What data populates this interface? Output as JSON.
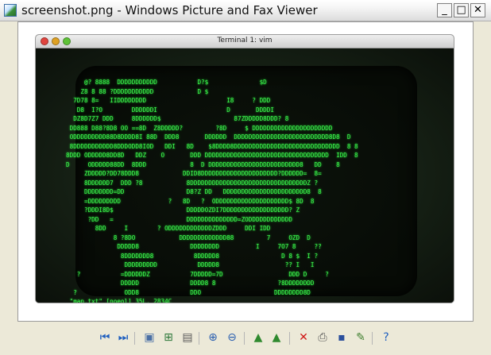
{
  "window": {
    "title": "screenshot.png - Windows Picture and Fax Viewer",
    "minimize_glyph": "_",
    "maximize_glyph": "□",
    "close_glyph": "✕"
  },
  "terminal": {
    "title": "Terminal 1: vim",
    "lines": [
      "     @? 8888  DDDDDDDDDDD           D?$              $D",
      "    Z8 8 88 ?DDDDDDDDDDD            D $",
      "  7D78 8=   IIDDDDDDDD                      I8     ? DDD",
      "   D8  I?O        DDDDDDI                   D       DDDDI",
      "  DZ8D7Z7 DDD     8DDDDDD$                    87ZDDDDD8DDD? 8",
      " DD888 D88?8D8 OO ==8D  Z8DDDDD?         ?8D     $ DDDDDDDDDDDDDDDDDDDDDD",
      " ODDDDDDDDD88D8DDDD8I 88D  DDD8       DDDDDD  DDDDDDDDDDDDDDDDDDDDDDDDDD8D8  D",
      " 8DDDDDDDDDDD8DDDODD8IOD   DDI   8D    $8DDDD8DDDDDDDDDDDDDDDDDDDDDDDDDDDDD  8 8",
      "8DDD ODDDDD8DD8D   DDZ    O       DDD DDDDDDDDDDDDDDDDDDDDDDDDDDDDDDDDDD  IDD  8",
      "D     ODDDDD88DD  8DDD            8  D DDDDDDDDDDDDDDDDDDDDDDDDD8   DD    8",
      "     ZDDDDD?DD78DDD8            DDID8DDDDDDDDDDDDDDDDDDDDD?DDDDDD=  8=",
      "     8DDDDDD7  DDD ?8            8DDDDDDDDDDDDDDDDDDDDDDDDDDDDDDDDZ ?",
      "     DDDDDDDD=DD                 D8?Z DD   DDDDDDDDDDDDDDDDDDDDDDD8  8",
      "     =DDDDDDDDD             ?   8D   ?  ODDDDDDDDDDDDDDDDDDDD$ 8D  8",
      "     ?DDDI8D$                    DDDDDOZDI7DDDDDDDDDDDDDDDDDD? Z",
      "      ?DD   =                    DDDDDDDDDDDDDD=ZODDDDDDDDDDDD",
      "        8DD     I        ? ODDDDDDDDDDDDZDDD     DDI IDD",
      "             8 ?8DO            DDDDDDDDDDDDD88         7     OZD  D",
      "              DDDDD8              DDDDDDDD          I     7O7 8     ??",
      "               8DDDDDDD8           8DDDDD8                 D 8 $  I ?",
      "                DDDDDDDDD           DDDDD8                  ?? I   I",
      "   ?           =DDDDDDZ           7DDDDD=7D                  DDD D     ?",
      "               DDDDD              DDDD8 8                 ?8DDDDDDDD",
      "  ?             ODD8              DDO                    DDDDDDDD8D",
      " \"map.txt\" [noeol] 35L, 2834C"
    ]
  },
  "toolbar": {
    "items": [
      {
        "name": "previous-image-button",
        "glyph": "⏮",
        "color": "#1f5fbf"
      },
      {
        "name": "next-image-button",
        "glyph": "⏭",
        "color": "#1f5fbf"
      },
      {
        "name": "best-fit-button",
        "glyph": "▣",
        "color": "#4a6fa5"
      },
      {
        "name": "actual-size-button",
        "glyph": "⊞",
        "color": "#2f7a3c"
      },
      {
        "name": "slide-show-button",
        "glyph": "▤",
        "color": "#5a5a5a"
      },
      {
        "name": "zoom-in-button",
        "glyph": "⊕",
        "color": "#2a5fb0"
      },
      {
        "name": "zoom-out-button",
        "glyph": "⊖",
        "color": "#2a5fb0"
      },
      {
        "name": "rotate-clockwise-button",
        "glyph": "▲",
        "color": "#2f8a2f"
      },
      {
        "name": "rotate-counterclockwise-button",
        "glyph": "▲",
        "color": "#2f8a2f"
      },
      {
        "name": "delete-button",
        "glyph": "✕",
        "color": "#d01818"
      },
      {
        "name": "print-button",
        "glyph": "⎙",
        "color": "#555555"
      },
      {
        "name": "save-button",
        "glyph": "▪",
        "color": "#2b4f9c"
      },
      {
        "name": "edit-button",
        "glyph": "✎",
        "color": "#3f7f2f"
      },
      {
        "name": "help-button",
        "glyph": "?",
        "color": "#1f5fbf"
      }
    ]
  }
}
